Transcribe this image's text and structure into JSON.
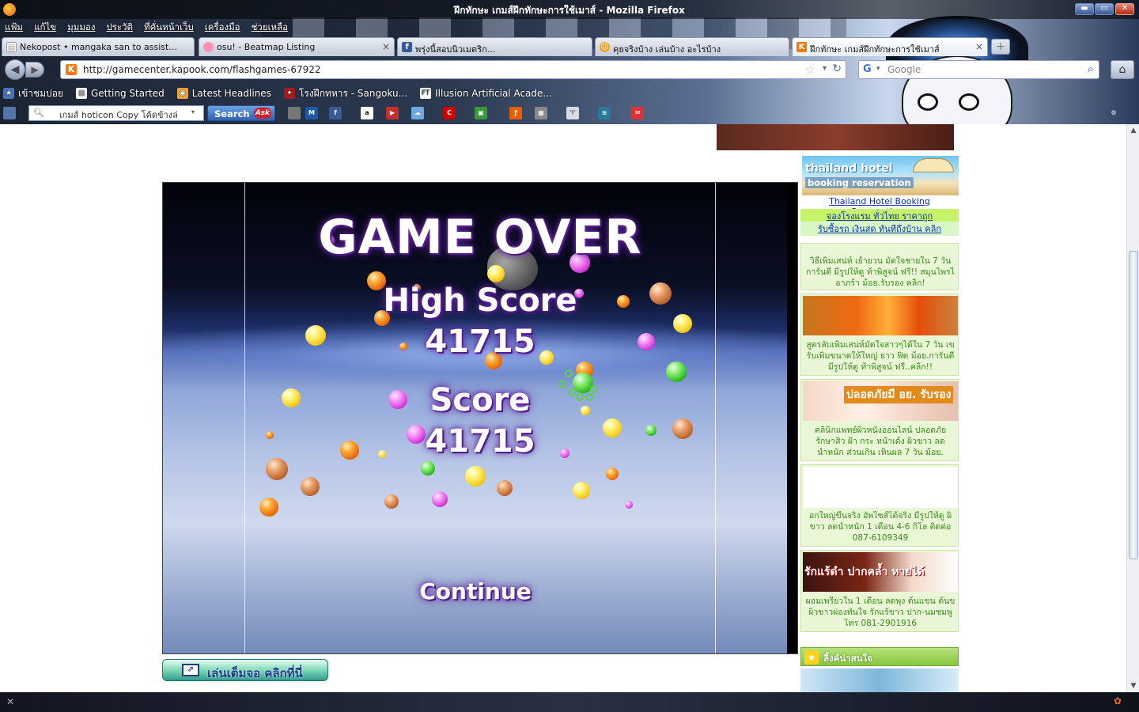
{
  "window": {
    "title": "ฝึกทักษะ เกมส์ฝึกทักษะการใช้เมาส์ - Mozilla Firefox",
    "minimize": "▬",
    "maximize": "▭",
    "close": "✕"
  },
  "menu": [
    "แฟ้ม",
    "แก้ไข",
    "มุมมอง",
    "ประวัติ",
    "ที่คั่นหน้าเว็บ",
    "เครื่องมือ",
    "ช่วยเหลือ"
  ],
  "tabs": [
    {
      "label": "Nekopost • mangaka san to assistant san...",
      "icon": "page-icon",
      "active": false
    },
    {
      "label": "osu! - Beatmap Listing",
      "icon": "osu-icon",
      "active": false
    },
    {
      "label": "พรุ่งนี้สอบนิวเมตริก...",
      "icon": "facebook-icon",
      "active": false
    },
    {
      "label": "คุยจริงบ้าง เล่นบ้าง อะไรบ้าง",
      "icon": "smiley-icon",
      "active": false
    },
    {
      "label": "ฝึกทักษะ เกมส์ฝึกทักษะการใช้เมาส์",
      "icon": "kapook-icon",
      "active": true
    }
  ],
  "tab_close": "×",
  "tab_new": "+",
  "nav": {
    "back": "◀",
    "forward": "▶",
    "url": "http://gamecenter.kapook.com/flashgames-67922",
    "url_icon_letter": "K",
    "bookmark_star": "☆",
    "dropdown": "▾",
    "reload": "↻",
    "search_engine": "Google",
    "search_go": "⌕",
    "home": "⌂"
  },
  "bookmarks": [
    {
      "label": "เข้าชมบ่อย",
      "icon": "frequent-icon"
    },
    {
      "label": "Getting Started",
      "icon": "page-icon"
    },
    {
      "label": "Latest Headlines",
      "icon": "rss-icon"
    },
    {
      "label": "โรงฝึกทหาร - Sangoku...",
      "icon": "sangoku-icon"
    },
    {
      "label": "Illusion Artificial Acade...",
      "icon": "illusion-icon"
    }
  ],
  "ask_toolbar": {
    "input_value": "เกมส์ hoticon Copy โค้ดข้างล่",
    "search_label": "Search",
    "ask_badge": "Ask",
    "icon_names": [
      "myspace-icon",
      "facebook-icon",
      "amazon-icon",
      "youtube-icon",
      "weather-icon",
      "cnn-icon",
      "games-icon",
      "firefox-icon",
      "photos-icon",
      "horoscope-icon",
      "radio-icon",
      "email-icon"
    ]
  },
  "game": {
    "title": "GAME OVER",
    "high_score_label": "High Score",
    "high_score": "41715",
    "score_label": "Score",
    "score": "41715",
    "continue_label": "Continue",
    "fullscreen_label": "เล่นเต็มจอ คลิกที่นี่"
  },
  "sidebar": {
    "hotel_title_1": "thailand hotel",
    "hotel_title_2": "booking reservation",
    "hotel_links": [
      "Thailand Hotel Booking Reservations",
      "จองโรงแรม ทั่วไทย ราคาถูก",
      "รับซื้อรถ เงินสด ทันทีถึงบ้าน คลิก"
    ],
    "ads": [
      {
        "lines": [
          "วิธีเพิ่มเสน่ห์ เย้ายวน มัดใจชายใน 7 วัน",
          "การันตี มีรูปให้ดู ท้าพิสูจน์ ฟรี!! สมุนไพรไ",
          "อาภร้า ม้อย.รับรอง คลิ๊ก!"
        ]
      },
      {
        "lines": [
          "สูตรลับเพิ่มเสน่ห์มัดใจสาวๆได้ใน 7 วัน เข",
          "รับเพิ่มขนาดให้ใหญ่ ยาว ฟิต ม้อย.การันตี",
          "มีรูปให้ดู ท้าพิสูจน์ ฟรี..คลิ๊ก!!"
        ]
      },
      {
        "lines": [
          "คลินิกแพทย์ผิวหนังออนไลน์ ปลอดภัย",
          "รักษาสิว ฝ้า กระ หน้าเด้ง ผิวขาว ลด",
          "น้ำหนัก ส่วนเกิน เห็นผล 7 วัน ม้อย."
        ],
        "image_text": "ปลอดภัยมี อย. รับรอง"
      },
      {
        "lines": [
          "อกใหญ่ขึ้นจริง อัพไซส์ได้จริง มีรูปให้ดู ผิ",
          "ขาว ลดน้ำหนัก 1 เดือน 4-6 กิโล ติดต่อ",
          "087-6109349"
        ]
      },
      {
        "lines": [
          "ผอมเพรียวใน 1 เดือน ลดพุง ต้นแขน ต้นข",
          "ผิวขาวผ่องทันใจ รักแร้ขาว ปาก-นมชมพู",
          "โทร 081-2901916"
        ],
        "image_text": "รักแร้ดำ ปากคล้ำ หายได้"
      }
    ],
    "links_header": "ลิ้งค์น่าสนใจ",
    "links_star": "★"
  },
  "scrollbar": {
    "up": "▲",
    "down": "▼"
  },
  "status": {
    "left_icon": "✕"
  }
}
